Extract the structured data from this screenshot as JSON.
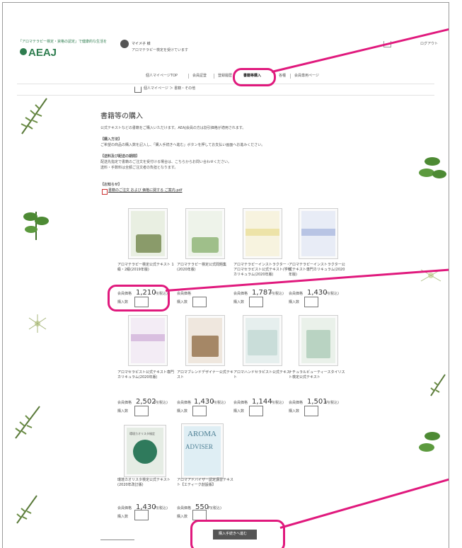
{
  "header": {
    "tagline": "「アロマテラピー検定・資格の認定」で健康的な生活を",
    "logo_text": "AEAJ",
    "user_name": "マイメ子 様",
    "user_sub": "アロマテラピー検定を受けています",
    "logout": "ログアウト"
  },
  "nav": {
    "items": [
      "個人マイページTOP",
      "会員証登",
      "登録履歴",
      "書籍等購入",
      "各種",
      "会員専用ページ"
    ],
    "active_index": 3
  },
  "breadcrumb": {
    "text": "個人マイページ ＞ 書籍・その他"
  },
  "page": {
    "title": "書籍等の購入",
    "intro": "公式テキストなどの書籍をご購入いただけます。AEAJ会員の方は割引価格が適用されます。",
    "section1_title": "【購入方法】",
    "section1_text": "ご希望の商品の購入数を記入し、「購入手続きへ進む」ボタンを押してお支払い画面へお進みください。",
    "section2_title": "【送料及び配送の期間】",
    "section2_text1": "配送先指定で書籍のご注文を受付ける場合は、こちらからお問い合わせください。",
    "section2_text2": "送料・手数料は全額ご注文者の負担となります。",
    "notice_title": "【お知らせ】",
    "notice_link": "書籍のご注文 および 価格に関する ご案内.pdf"
  },
  "products": [
    {
      "title": "アロマテラピー検定公式テキスト 1級・2級(2019年版)",
      "price_label": "会員価格",
      "price": "1,210",
      "unit": "円(税込)",
      "qty_label": "購入数",
      "cover": "#e9efe2"
    },
    {
      "title": "アロマテラピー検定公式問題集(2020年版)",
      "price_label": "会員価格",
      "price": "",
      "unit": "",
      "qty_label": "購入数",
      "cover": "#eef3ea"
    },
    {
      "title": "アロマテラピーインストラクター・アロマセラピスト公式テキスト(学科カリキュラム(2020年版)",
      "price_label": "会員価格",
      "price": "1,787",
      "unit": "円(税込)",
      "qty_label": "購入数",
      "cover": "#f7f3df"
    },
    {
      "title": "アロマテラピーインストラクター公式テキスト専門カリキュラム(2020年版)",
      "price_label": "会員価格",
      "price": "1,430",
      "unit": "円(税込)",
      "qty_label": "購入数",
      "cover": "#e8ecf6"
    },
    {
      "title": "アロマセラピスト公式テキスト専門カリキュラム(2020年版)",
      "price_label": "会員価格",
      "price": "2,502",
      "unit": "円(税込)",
      "qty_label": "購入数",
      "cover": "#f3ecf5"
    },
    {
      "title": "アロマブレンドデザイナー公式テキスト",
      "price_label": "会員価格",
      "price": "1,430",
      "unit": "円(税込)",
      "qty_label": "購入数",
      "cover": "#efe7de"
    },
    {
      "title": "アロマハンドセラピスト公式テキスト",
      "price_label": "会員価格",
      "price": "1,144",
      "unit": "円(税込)",
      "qty_label": "購入数",
      "cover": "#e6efee"
    },
    {
      "title": "ナチュラルビューティースタイリスト検定公式テキスト",
      "price_label": "会員価格",
      "price": "1,501",
      "unit": "円(税込)",
      "qty_label": "購入数",
      "cover": "#eaf1ea"
    },
    {
      "title": "環境カオリスタ検定公式テキスト(2020年改訂版)",
      "price_label": "会員価格",
      "price": "1,430",
      "unit": "円(税込)",
      "qty_label": "購入数",
      "cover": "#e5ece4"
    },
    {
      "title": "アロマアドバイザー認定講習テキスト【エティーク創設版】",
      "price_label": "会員価格",
      "price": "550",
      "unit": "円(税込)",
      "qty_label": "購入数",
      "cover": "#dfeef4"
    }
  ],
  "cover_text": {
    "aroma": "AROMA",
    "adviser": "ADVISER",
    "kankyo": "環境カオリスタ検定"
  },
  "submit_label": "購入手続きへ進む",
  "colors": {
    "highlight": "#e0197d",
    "logo": "#2e7d4f"
  }
}
